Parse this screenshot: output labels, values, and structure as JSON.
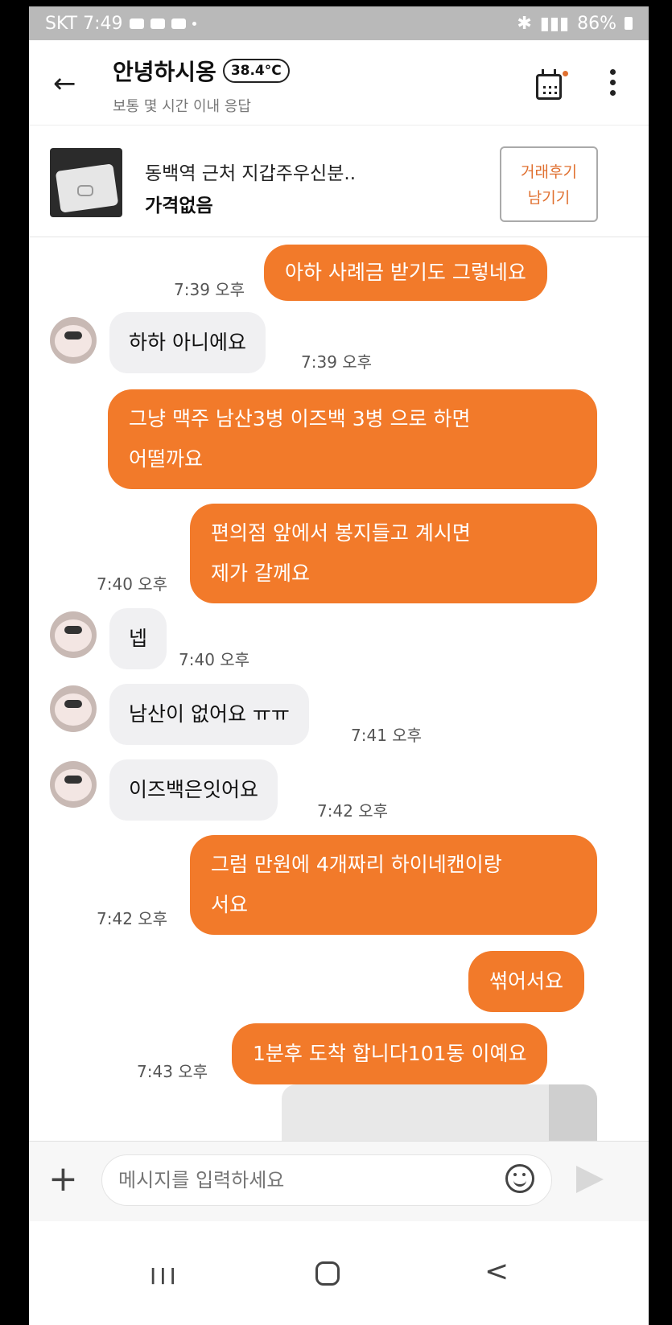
{
  "status_bar": {
    "carrier_time": "SKT 7:49",
    "battery": "86%"
  },
  "header": {
    "back_icon": "←",
    "name": "안녕하시옹",
    "temperature": "38.4°C",
    "response_time": "보통 몇 시간 이내 응답"
  },
  "product": {
    "title": "동백역 근처 지갑주우신분..",
    "price": "가격없음",
    "review_button": "거래후기\n남기기"
  },
  "messages": [
    {
      "from": "me",
      "text": "아하 사례금 받기도 그렇네요",
      "time": "7:39 오후"
    },
    {
      "from": "other",
      "text": "하하 아니에요",
      "time": "7:39 오후"
    },
    {
      "from": "me",
      "text": "그냥 맥주 남산3병 이즈백 3병 으로 하면\n어떨까요",
      "time": ""
    },
    {
      "from": "me",
      "text": "편의점 앞에서 봉지들고 계시면\n제가 갈께요",
      "time": "7:40 오후"
    },
    {
      "from": "other",
      "text": "넵",
      "time": "7:40 오후"
    },
    {
      "from": "other",
      "text": "남산이 없어요 ㅠㅠ",
      "time": "7:41 오후"
    },
    {
      "from": "other",
      "text": "이즈백은잇어요",
      "time": "7:42 오후"
    },
    {
      "from": "me",
      "text": "그럼 만원에 4개짜리 하이네캔이랑\n서요",
      "time": "7:42 오후"
    },
    {
      "from": "me",
      "text": "썪어서요",
      "time": ""
    },
    {
      "from": "me",
      "text": "1분후 도착 합니다101동 이예요",
      "time": "7:43 오후"
    }
  ],
  "input": {
    "placeholder": "메시지를 입력하세요",
    "plus_icon": "+"
  },
  "nav": {
    "recent": "III",
    "back": "<"
  },
  "colors": {
    "my_bubble": "#f27a2a",
    "other_bubble": "#f0f0f2",
    "accent": "#e07030"
  }
}
